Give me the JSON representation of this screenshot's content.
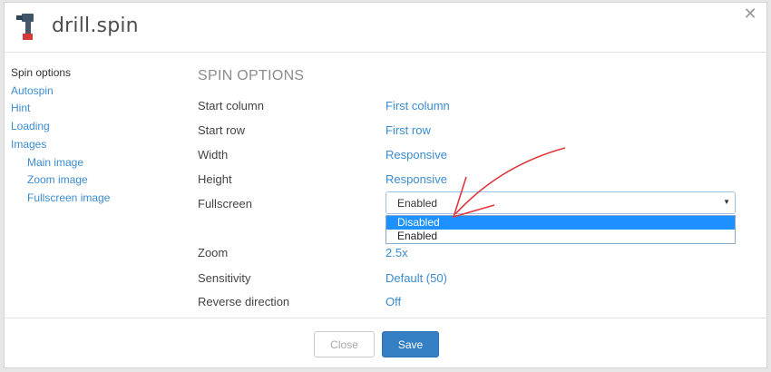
{
  "app": {
    "title": "drill.spin"
  },
  "sidebar": {
    "items": [
      {
        "label": "Spin options"
      },
      {
        "label": "Autospin"
      },
      {
        "label": "Hint"
      },
      {
        "label": "Loading"
      },
      {
        "label": "Images"
      },
      {
        "label": "Main image"
      },
      {
        "label": "Zoom image"
      },
      {
        "label": "Fullscreen image"
      }
    ]
  },
  "section": {
    "title": "SPIN OPTIONS"
  },
  "options": [
    {
      "label": "Start column",
      "value": "First column"
    },
    {
      "label": "Start row",
      "value": "First row"
    },
    {
      "label": "Width",
      "value": "Responsive"
    },
    {
      "label": "Height",
      "value": "Responsive"
    },
    {
      "label": "Fullscreen",
      "value": "Enabled"
    },
    {
      "label": "Zoom",
      "value": "2.5x"
    },
    {
      "label": "Sensitivity",
      "value": "Default (50)"
    },
    {
      "label": "Reverse direction",
      "value": "Off"
    }
  ],
  "fullscreen_dropdown": {
    "options": [
      "Disabled",
      "Enabled"
    ],
    "highlighted": "Disabled"
  },
  "footer": {
    "close_label": "Close",
    "save_label": "Save"
  },
  "colors": {
    "accent": "#3b8ccf",
    "primary_button": "#3580c4",
    "highlight": "#1e90ff",
    "annotation": "#e0353b"
  },
  "icons": {
    "app": "drill-icon",
    "close": "close-icon",
    "caret": "caret-down-icon",
    "annotation": "red-arrow-annotation"
  }
}
